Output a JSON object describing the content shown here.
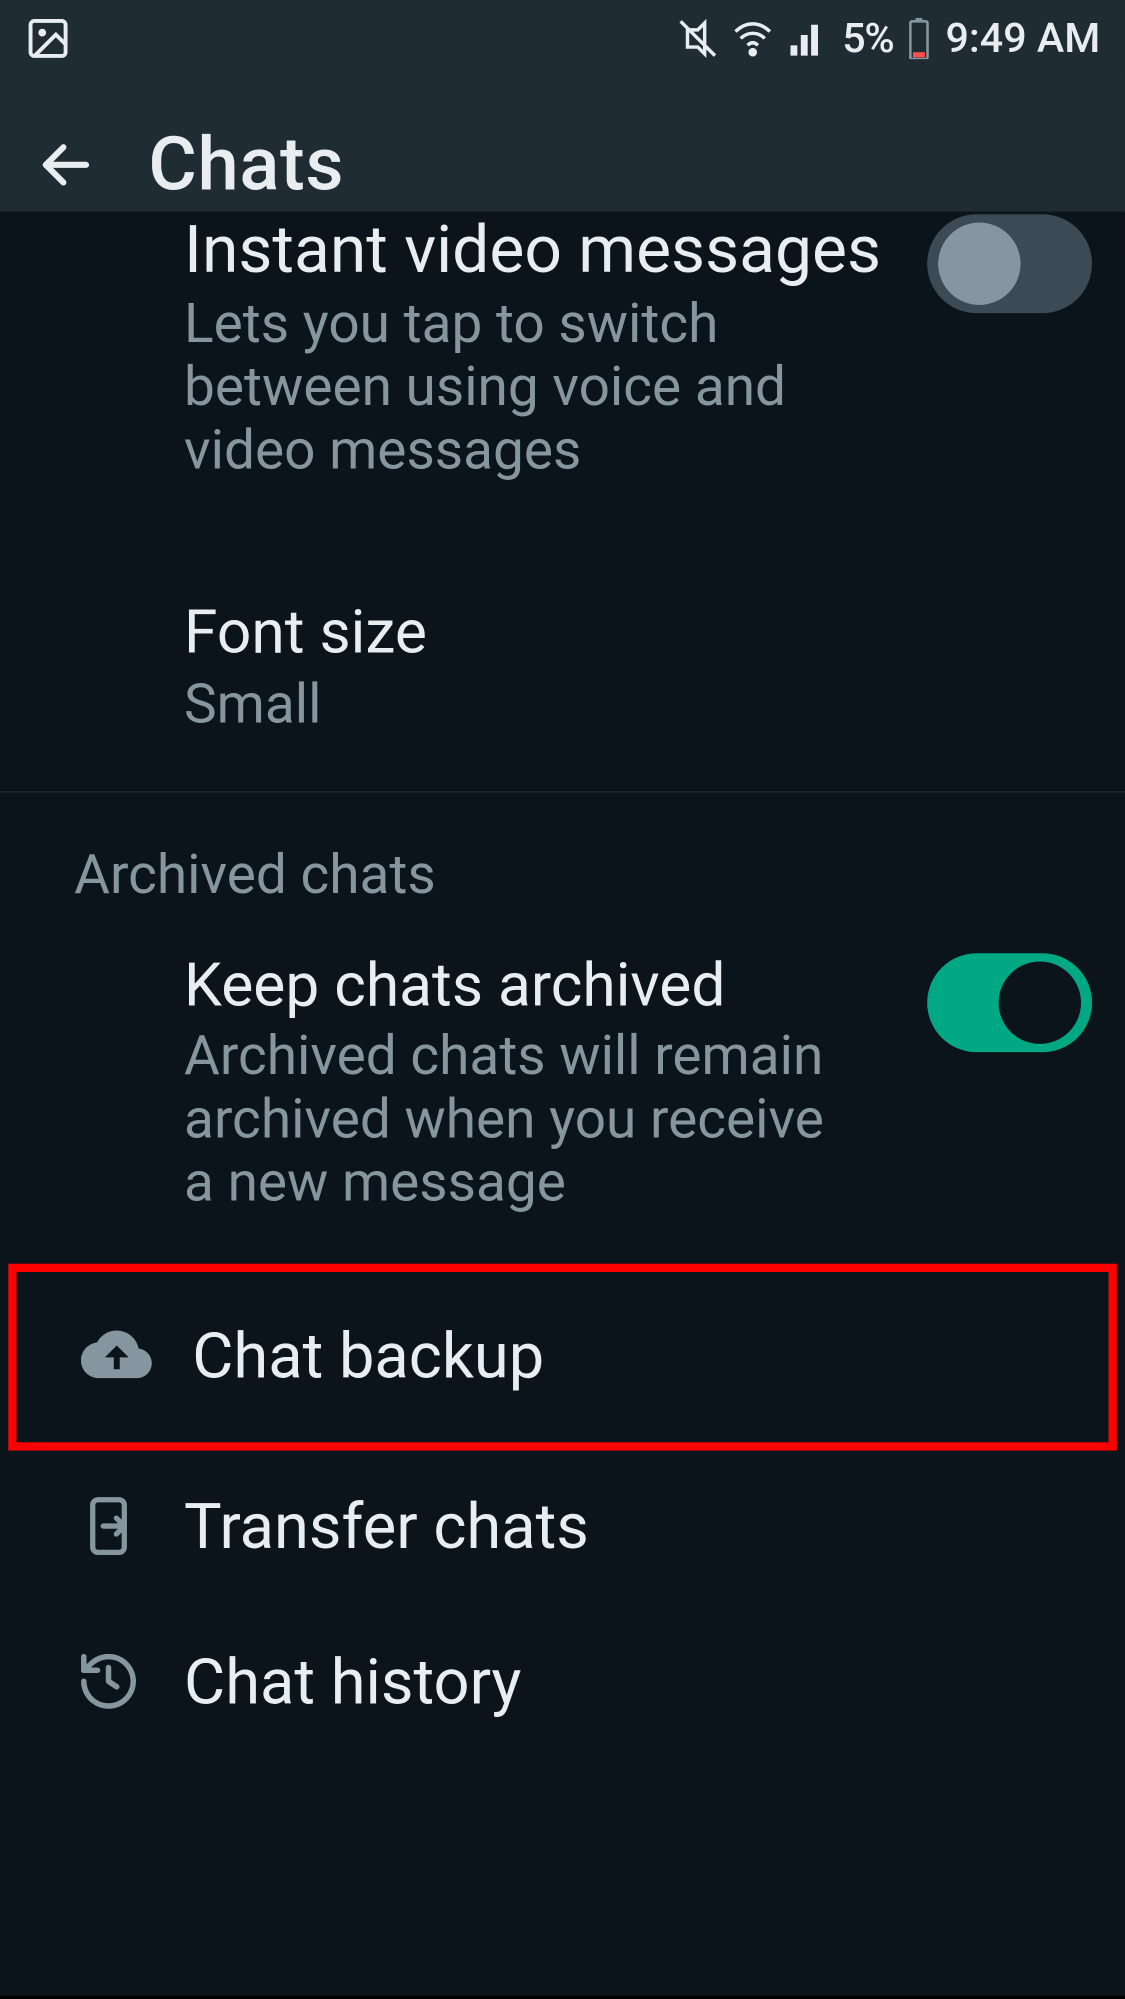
{
  "status": {
    "battery_percent": "5%",
    "time": "9:49 AM"
  },
  "appbar": {
    "title": "Chats"
  },
  "rows": {
    "instant_video": {
      "title": "Instant video messages",
      "subtitle": "Lets you tap to switch between using voice and video messages",
      "toggle_on": false
    },
    "font_size": {
      "title": "Font size",
      "value": "Small"
    }
  },
  "section_archived": {
    "header": "Archived chats",
    "keep_archived": {
      "title": "Keep chats archived",
      "subtitle": "Archived chats will remain archived when you receive a new message",
      "toggle_on": true
    }
  },
  "actions": {
    "chat_backup": "Chat backup",
    "transfer_chats": "Transfer chats",
    "chat_history": "Chat history"
  }
}
